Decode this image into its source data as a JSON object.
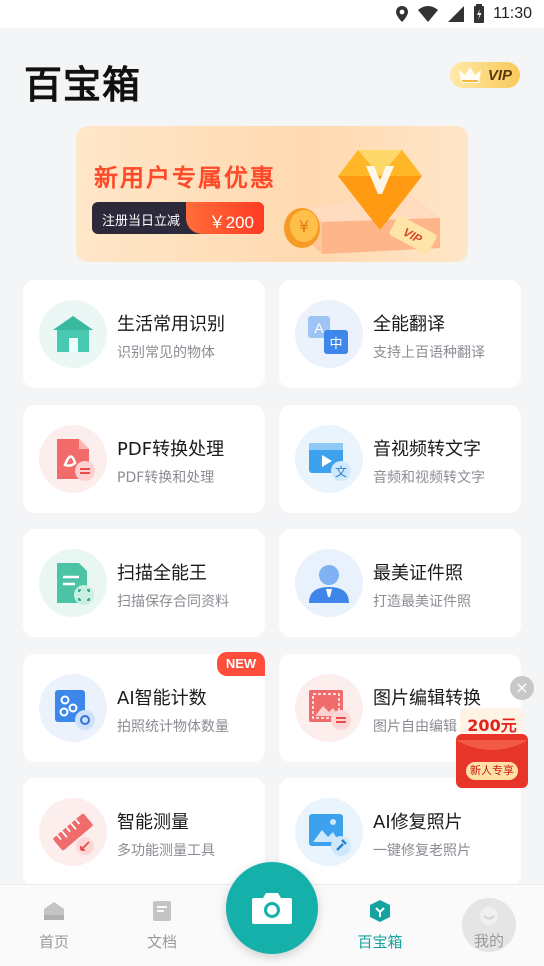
{
  "status_bar": {
    "time": "11:30"
  },
  "header": {
    "title": "百宝箱",
    "vip_label": "VIP"
  },
  "banner": {
    "title": "新用户专属优惠",
    "pill_label": "注册当日立减",
    "amount": "￥200",
    "art_text": "VIP"
  },
  "tools": [
    {
      "title": "生活常用识别",
      "subtitle": "识别常见的物体",
      "icon": "house-icon"
    },
    {
      "title": "全能翻译",
      "subtitle": "支持上百语种翻译",
      "icon": "translate-icon",
      "icon_text_a": "A",
      "icon_text_b": "中"
    },
    {
      "title": "PDF转换处理",
      "subtitle": "PDF转换和处理",
      "icon": "pdf-icon"
    },
    {
      "title": "音视频转文字",
      "subtitle": "音频和视频转文字",
      "icon": "video-text-icon",
      "icon_text": "文"
    },
    {
      "title": "扫描全能王",
      "subtitle": "扫描保存合同资料",
      "icon": "scan-document-icon"
    },
    {
      "title": "最美证件照",
      "subtitle": "打造最美证件照",
      "icon": "id-photo-icon"
    },
    {
      "title": "AI智能计数",
      "subtitle": "拍照统计物体数量",
      "icon": "count-icon",
      "badge": "NEW"
    },
    {
      "title": "图片编辑转换",
      "subtitle": "图片自由编辑",
      "icon": "image-edit-icon"
    },
    {
      "title": "智能测量",
      "subtitle": "多功能测量工具",
      "icon": "ruler-icon"
    },
    {
      "title": "AI修复照片",
      "subtitle": "一键修复老照片",
      "icon": "photo-repair-icon"
    }
  ],
  "promo": {
    "amount": "200元",
    "label": "新人专享",
    "close": "×"
  },
  "bottom_nav": {
    "items": [
      {
        "label": "首页",
        "icon": "home-icon"
      },
      {
        "label": "文档",
        "icon": "document-icon"
      },
      {
        "label": "百宝箱",
        "icon": "toolbox-icon",
        "active": true
      },
      {
        "label": "我的",
        "icon": "profile-icon"
      }
    ],
    "center_icon": "camera-icon"
  },
  "colors": {
    "accent": "#16b0aa",
    "promo_red": "#e2231a",
    "banner_red": "#ff4a2a"
  }
}
